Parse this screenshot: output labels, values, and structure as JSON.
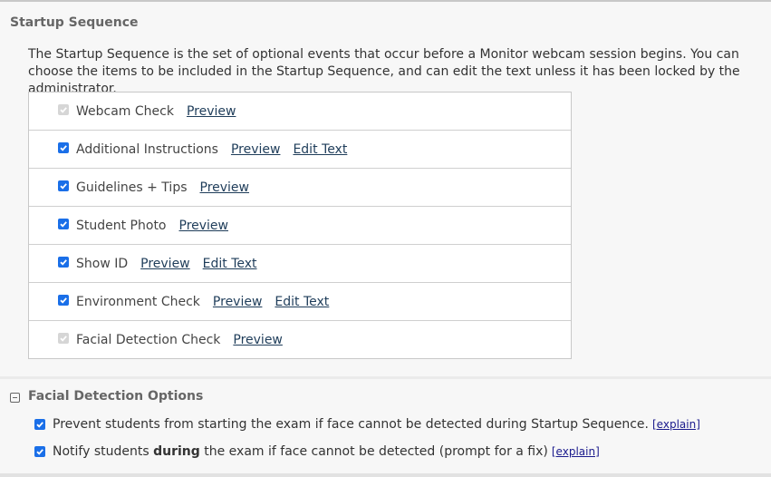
{
  "startup_sequence": {
    "title": "Startup Sequence",
    "description": "The Startup Sequence is the set of optional events that occur before a Monitor webcam session begins. You can choose the items to be included in the Startup Sequence, and can edit the text unless it has been locked by the administrator.",
    "items": [
      {
        "label": "Webcam Check",
        "checked": true,
        "disabled": true,
        "preview": "Preview",
        "edit": null
      },
      {
        "label": "Additional Instructions",
        "checked": true,
        "disabled": false,
        "preview": "Preview",
        "edit": "Edit Text"
      },
      {
        "label": "Guidelines + Tips",
        "checked": true,
        "disabled": false,
        "preview": "Preview",
        "edit": null
      },
      {
        "label": "Student Photo",
        "checked": true,
        "disabled": false,
        "preview": "Preview",
        "edit": null
      },
      {
        "label": "Show ID",
        "checked": true,
        "disabled": false,
        "preview": "Preview",
        "edit": "Edit Text"
      },
      {
        "label": "Environment Check",
        "checked": true,
        "disabled": false,
        "preview": "Preview",
        "edit": "Edit Text"
      },
      {
        "label": "Facial Detection Check",
        "checked": true,
        "disabled": true,
        "preview": "Preview",
        "edit": null
      }
    ]
  },
  "facial_detection": {
    "title": "Facial Detection Options",
    "options": [
      {
        "checked": true,
        "text_before": "Prevent students from starting the exam if face cannot be detected during Startup Sequence.",
        "bold": "",
        "text_after": "",
        "explain": "[explain]"
      },
      {
        "checked": true,
        "text_before": "Notify students ",
        "bold": "during",
        "text_after": " the exam if face cannot be detected (prompt for a fix)",
        "explain": "[explain]"
      }
    ]
  },
  "colors": {
    "checkbox_checked": "#1a6fe8",
    "checkbox_disabled": "#d6d6d6",
    "link": "#1f3d5a",
    "explain_link": "#1a1a8c"
  }
}
